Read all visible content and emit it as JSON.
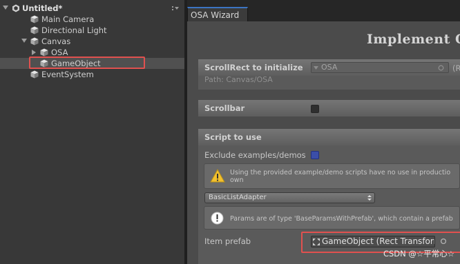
{
  "hierarchy": {
    "scene_name": "Untitled*",
    "items": [
      {
        "label": "Main Camera"
      },
      {
        "label": "Directional Light"
      },
      {
        "label": "Canvas"
      },
      {
        "label": "OSA"
      },
      {
        "label": "GameObject"
      },
      {
        "label": "EventSystem"
      }
    ]
  },
  "wizard": {
    "tab_label": "OSA Wizard",
    "title": "Implement O",
    "scrollrect": {
      "header": "ScrollRect to initialize",
      "field_value": "OSA",
      "field_suffix": "(R",
      "path": "Path: Canvas/OSA"
    },
    "scrollbar": {
      "header": "Scrollbar"
    },
    "script": {
      "header": "Script to use",
      "exclude_label": "Exclude examples/demos",
      "exclude_checked": true,
      "warning_line1": "Using the provided example/demo scripts have no use in productio",
      "warning_line2": "own",
      "selected_script": "BasicListAdapter",
      "info_text": "Params are of type 'BaseParamsWithPrefab', which contain a prefab",
      "item_prefab_label": "Item prefab",
      "item_prefab_value": "GameObject (Rect Transform"
    }
  },
  "watermark": "CSDN @☆平常心☆",
  "colors": {
    "highlight_box": "#e2514f",
    "tab_accent": "#3c75c4",
    "checkbox_checked": "#3b4ea8"
  }
}
